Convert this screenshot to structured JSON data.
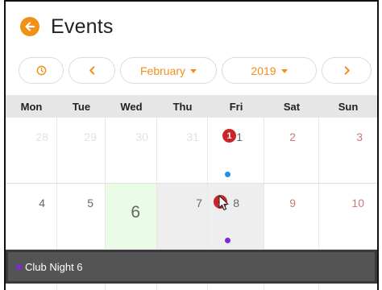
{
  "header": {
    "title": "Events",
    "back_icon": "arrow-left-icon"
  },
  "toolbar": {
    "today_icon": "clock-icon",
    "prev_icon": "chevron-left-icon",
    "month": "February",
    "year": "2019",
    "next_icon": "chevron-right-icon"
  },
  "weekdays": [
    "Mon",
    "Tue",
    "Wed",
    "Thu",
    "Fri",
    "Sat",
    "Sun"
  ],
  "week1": [
    "28",
    "29",
    "30",
    "31",
    "1",
    "2",
    "3"
  ],
  "week2": [
    "4",
    "5",
    "6",
    "7",
    "8",
    "9",
    "10"
  ],
  "badges": {
    "feb1": "1",
    "feb8": "1"
  },
  "event": {
    "label": "Club Night 6",
    "color": "#7b2ad6"
  },
  "colors": {
    "accent": "#f39019",
    "badge": "#c9262b",
    "today_bg": "#eafbe6",
    "dot_blue": "#1e90e6",
    "dot_purple": "#7b2ad6"
  }
}
